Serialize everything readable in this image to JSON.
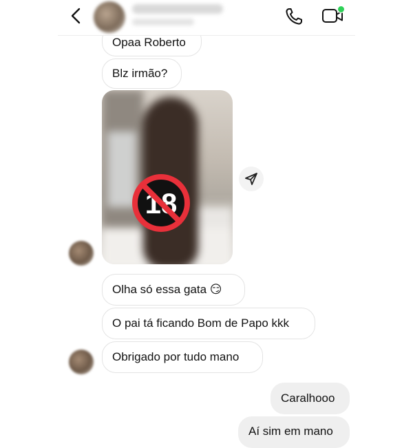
{
  "header": {
    "back_icon": "chevron-left-icon",
    "call_icon": "phone-icon",
    "video_icon": "video-camera-icon",
    "online_color": "#2fd158"
  },
  "messages": {
    "m0": "Opaa Roberto",
    "m1": "Blz irmão?",
    "m2": "Olha só essa gata 😏",
    "m3": "O pai tá ficando Bom de Papo kkk",
    "m4": "Obrigado por tudo mano",
    "m5": "Caralhooo",
    "m6": "Aí sim em mano"
  },
  "photo": {
    "overlay_icon": "no-under-18-icon",
    "overlay_text": "18",
    "share_icon": "send-icon"
  },
  "colors": {
    "incoming_border": "#e3e3e3",
    "outgoing_bg": "#efefef",
    "nsfw_red": "#e8303a"
  }
}
